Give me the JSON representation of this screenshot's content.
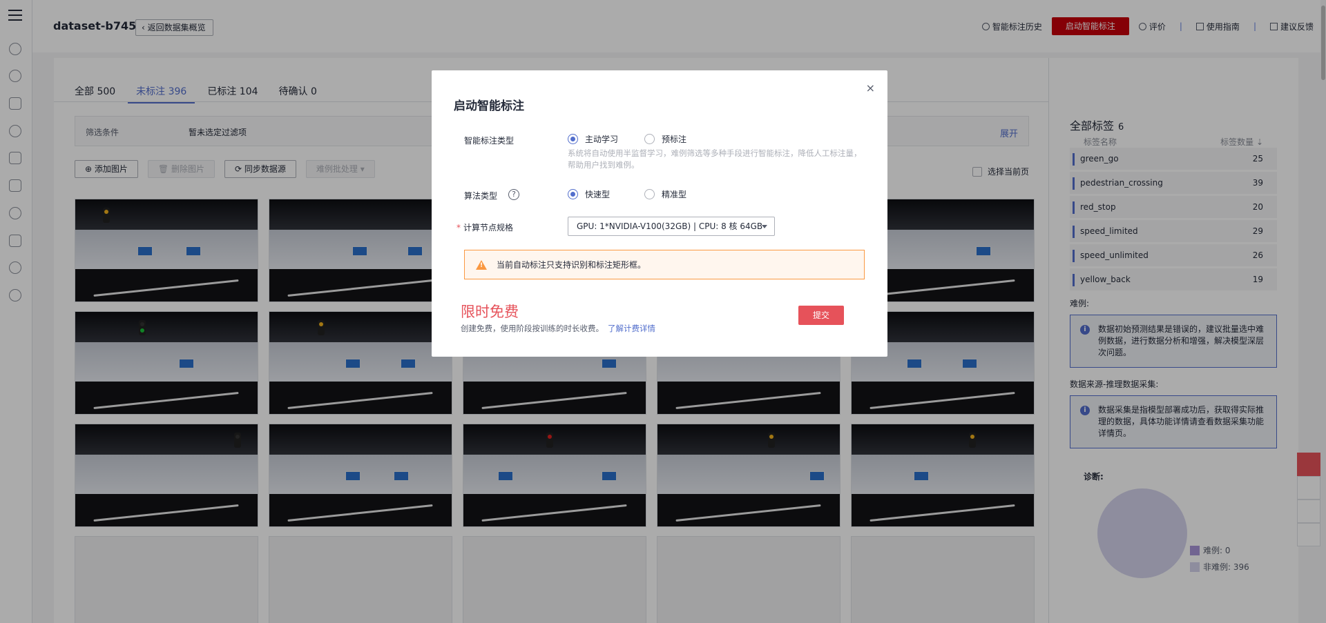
{
  "header": {
    "title": "dataset-b745",
    "back_label": "返回数据集概览",
    "history_label": "智能标注历史",
    "start_label": "启动智能标注",
    "rate_label": "评价",
    "guide_label": "使用指南",
    "feedback_label": "建议反馈",
    "sep": "|"
  },
  "tabs": [
    {
      "label": "全部 500"
    },
    {
      "label": "未标注 396"
    },
    {
      "label": "已标注 104"
    },
    {
      "label": "待确认 0"
    }
  ],
  "filter": {
    "label": "筛选条件",
    "value": "暂未选定过滤项",
    "expand": "展开"
  },
  "toolbar": {
    "add": "添加图片",
    "delete": "删除图片",
    "sync": "同步数据源",
    "batch": "难例批处理",
    "select_page": "选择当前页"
  },
  "side": {
    "title": "全部标签",
    "count": "6",
    "col_name": "标签名称",
    "col_count": "标签数量",
    "labels": [
      {
        "name": "green_go",
        "count": "25"
      },
      {
        "name": "pedestrian_crossing",
        "count": "39"
      },
      {
        "name": "red_stop",
        "count": "20"
      },
      {
        "name": "speed_limited",
        "count": "29"
      },
      {
        "name": "speed_unlimited",
        "count": "26"
      },
      {
        "name": "yellow_back",
        "count": "19"
      }
    ],
    "hard_title": "难例:",
    "hard_info": "数据初始预测结果是错误的，建议批量选中难例数据，进行数据分析和增强，解决模型深层次问题。",
    "source_title": "数据来源-推理数据采集:",
    "source_info": "数据采集是指模型部署成功后，获取得实际推理的数据，具体功能详情请查看数据采集功能详情页。",
    "diag_title": "诊断:",
    "legend_hard": "难例: 0",
    "legend_nonhard": "非难例: 396",
    "legend_colors": {
      "hard": "#a996d8",
      "nonhard": "#d4d2ec"
    }
  },
  "dialog": {
    "title": "启动智能标注",
    "close": "×",
    "type_label": "智能标注类型",
    "type_options": [
      "主动学习",
      "预标注"
    ],
    "type_desc": "系统将自动使用半监督学习，难例筛选等多种手段进行智能标注，降低人工标注量，帮助用户找到难例。",
    "algo_label": "算法类型",
    "algo_help": "?",
    "algo_options": [
      "快速型",
      "精准型"
    ],
    "node_required": "*",
    "node_label": "计算节点规格",
    "node_value": "GPU: 1*NVIDIA-V100(32GB) | CPU: 8 核 64GB",
    "warning": "当前自动标注只支持识别和标注矩形框。",
    "promo_title": "限时免费",
    "promo_desc": "创建免费，使用阶段按训练的时长收费。",
    "promo_link": "了解计费详情",
    "submit": "提交"
  },
  "colors": {
    "accent": "#526ecc",
    "brand_red": "#c7000b",
    "danger": "#e6525a",
    "warning": "#fa9841"
  }
}
